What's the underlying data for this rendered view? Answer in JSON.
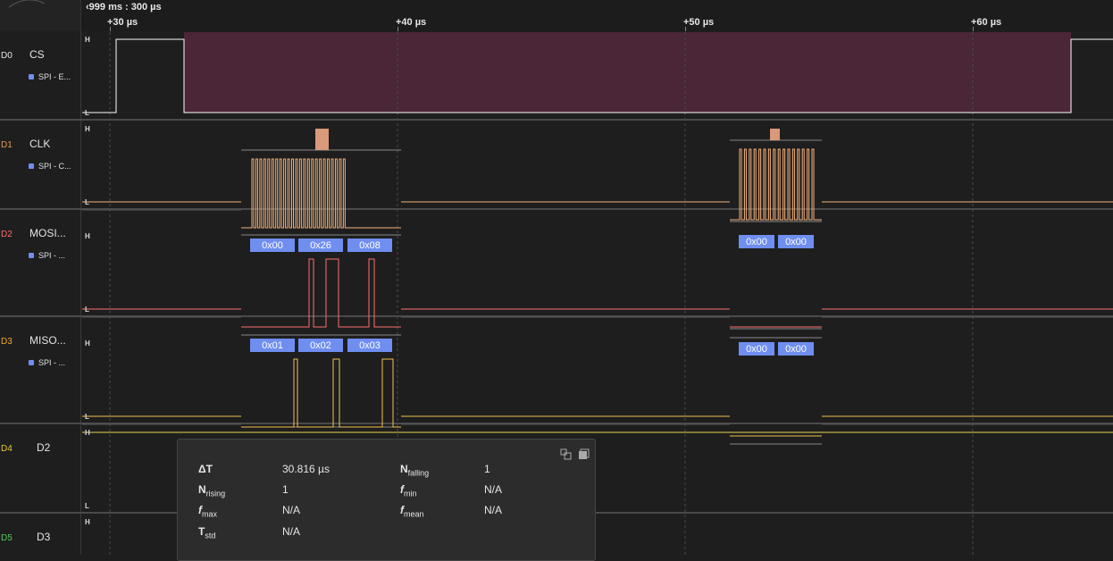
{
  "ruler": {
    "offset": "999 ms : 300 µs",
    "ticks": [
      "+30 µs",
      "+40 µs",
      "+50 µs",
      "+60 µs"
    ]
  },
  "levels": {
    "high": "H",
    "low": "L"
  },
  "channels": [
    {
      "id": "D0",
      "name": "CS",
      "analyzer": "SPI - E...",
      "color": "#ffffff",
      "id_color": "#e6e6e6"
    },
    {
      "id": "D1",
      "name": "CLK",
      "analyzer": "SPI - C...",
      "color": "#f2b27a",
      "id_color": "#e39a4f"
    },
    {
      "id": "D2",
      "name": "MOSI...",
      "analyzer": "SPI - ...",
      "color": "#ff6f6f",
      "id_color": "#ff6b6b"
    },
    {
      "id": "D3",
      "name": "MISO...",
      "analyzer": "SPI - ...",
      "color": "#f4c14b",
      "id_color": "#f0a830"
    },
    {
      "id": "D4",
      "name": "D2",
      "color": "#e8d54a",
      "id_color": "#e6c92a"
    },
    {
      "id": "D5",
      "name": "D3",
      "color": "#62d36b",
      "id_color": "#54c95a"
    }
  ],
  "decodes": {
    "mosi_a": [
      "0x00",
      "0x26",
      "0x08"
    ],
    "miso_a": [
      "0x01",
      "0x02",
      "0x03"
    ],
    "mosi_b": [
      "0x00",
      "0x00"
    ],
    "miso_b": [
      "0x00",
      "0x00"
    ]
  },
  "colors": {
    "cs_enable_fill": "#4a2636",
    "decode_box": "#6f8ef0",
    "accent": "#d9997a"
  },
  "measurement": {
    "rows": [
      {
        "label": "ΔT",
        "value": "30.816 µs"
      },
      {
        "label": "N",
        "sub": "falling",
        "value": "1"
      },
      {
        "label": "N",
        "sub": "rising",
        "value": "1"
      },
      {
        "label": "f",
        "sub": "min",
        "value": "N/A"
      },
      {
        "label": "f",
        "sub": "max",
        "value": "N/A"
      },
      {
        "label": "f",
        "sub": "mean",
        "value": "N/A"
      },
      {
        "label": "T",
        "sub": "std",
        "value": "N/A"
      }
    ],
    "icons": [
      "expand-icon",
      "copy-icon"
    ]
  }
}
